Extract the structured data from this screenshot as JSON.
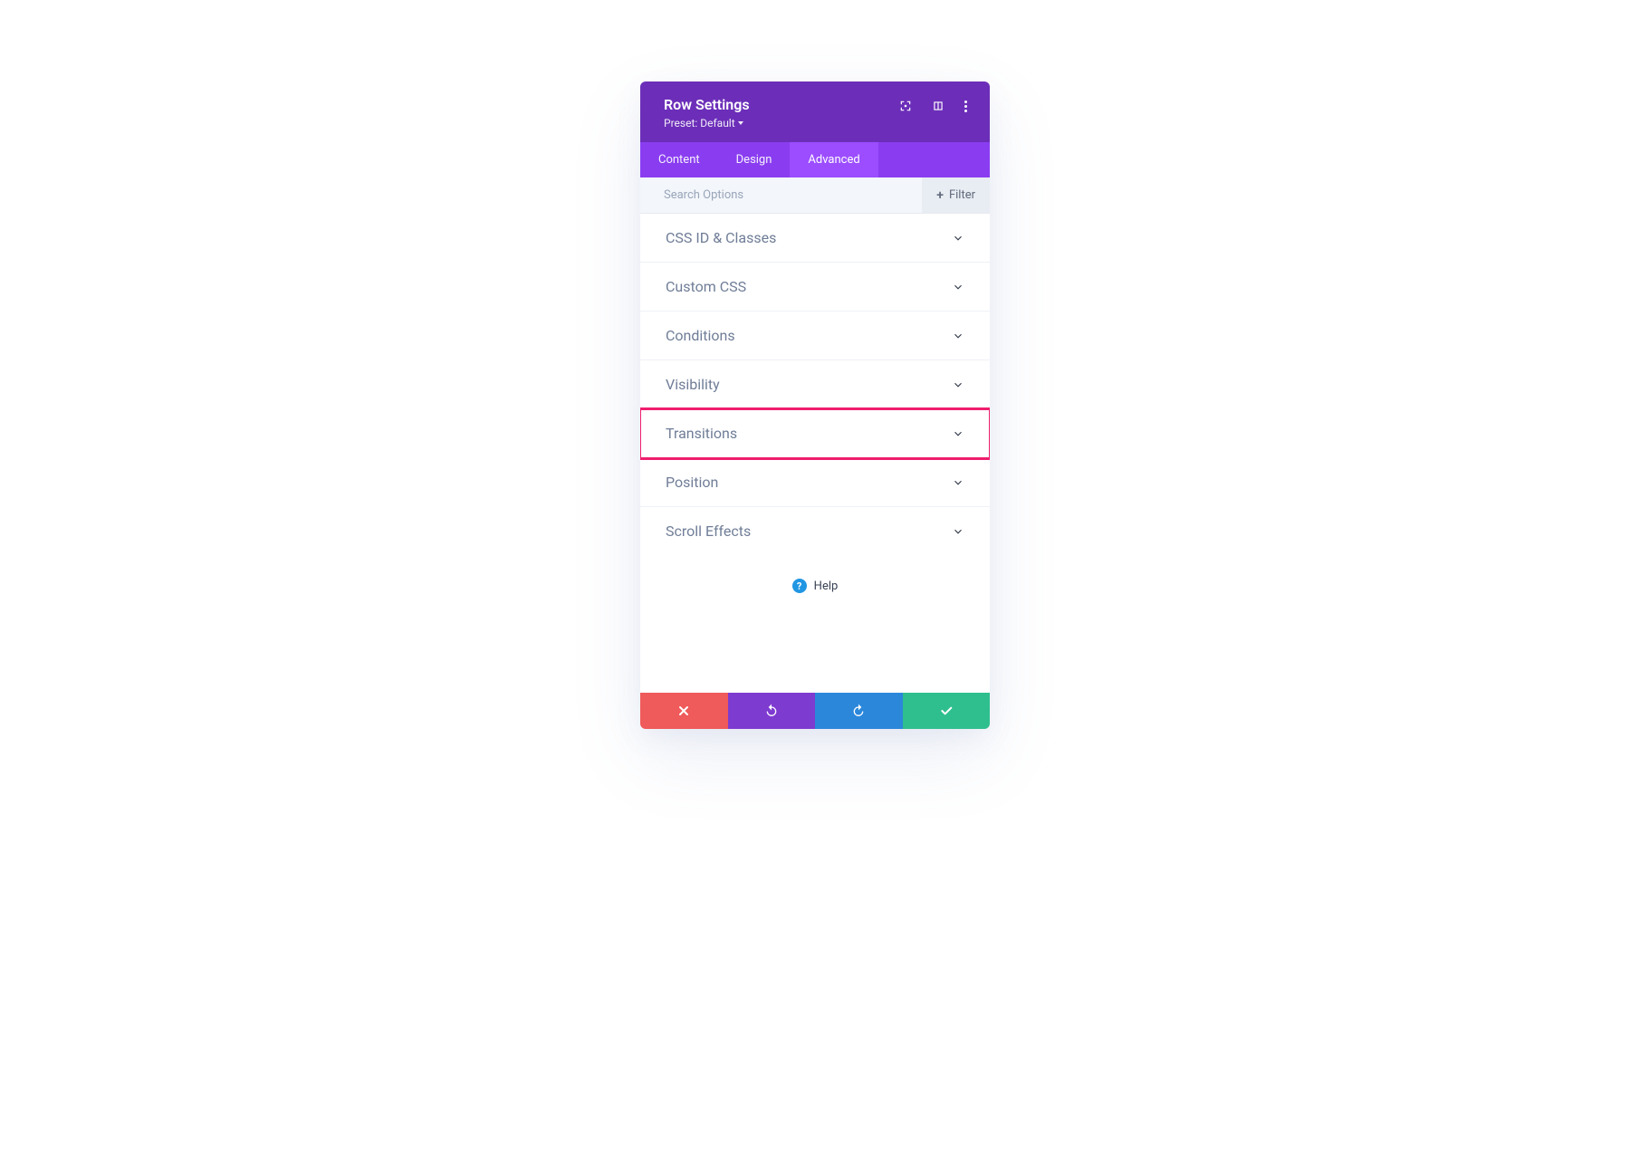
{
  "header": {
    "title": "Row Settings",
    "preset": "Preset: Default"
  },
  "tabs": {
    "items": [
      {
        "label": "Content",
        "active": false
      },
      {
        "label": "Design",
        "active": false
      },
      {
        "label": "Advanced",
        "active": true
      }
    ]
  },
  "search": {
    "placeholder": "Search Options",
    "filter_label": "Filter"
  },
  "options": [
    {
      "label": "CSS ID & Classes",
      "highlighted": false
    },
    {
      "label": "Custom CSS",
      "highlighted": false
    },
    {
      "label": "Conditions",
      "highlighted": false
    },
    {
      "label": "Visibility",
      "highlighted": false
    },
    {
      "label": "Transitions",
      "highlighted": true
    },
    {
      "label": "Position",
      "highlighted": false
    },
    {
      "label": "Scroll Effects",
      "highlighted": false
    }
  ],
  "help": {
    "label": "Help"
  },
  "colors": {
    "header_bg": "#6c2eb9",
    "tabs_bg": "#8a3df0",
    "tab_active_bg": "#9b4dff",
    "highlight_border": "#ef1e6e",
    "btn_red": "#ef5a5a",
    "btn_purple": "#7e3bd0",
    "btn_blue": "#2b87da",
    "btn_green": "#2fbf8f"
  }
}
